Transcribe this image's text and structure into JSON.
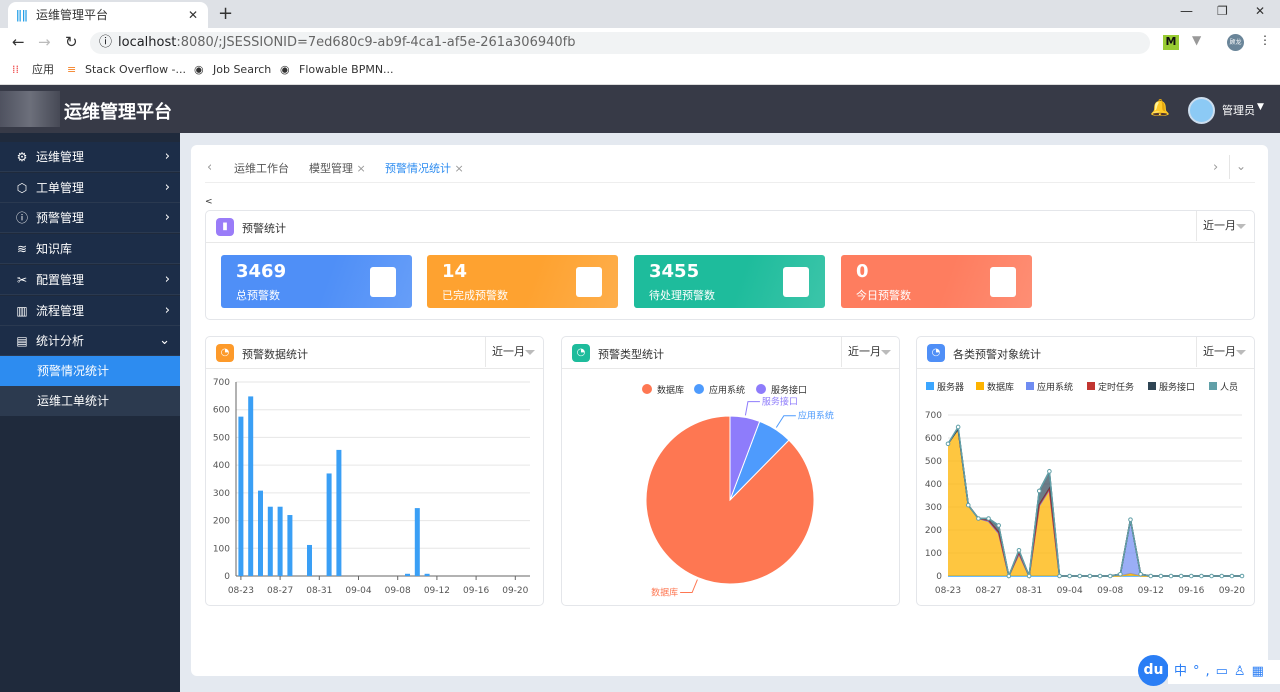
{
  "browser": {
    "tab_title": "运维管理平台",
    "url_host": "localhost",
    "url_rest": ":8080/;JSESSIONID=7ed680c9-ab9f-4ca1-af5e-261a306940fb",
    "bookmarks": [
      "应用",
      "Stack Overflow -...",
      "Job Search",
      "Flowable BPMN..."
    ],
    "profile": "顾龙"
  },
  "header": {
    "title": "运维管理平台",
    "user": "管理员"
  },
  "sidebar": {
    "items": [
      {
        "icon": "gear-icon",
        "label": "运维管理",
        "chev": "›"
      },
      {
        "icon": "cube-icon",
        "label": "工单管理",
        "chev": "›"
      },
      {
        "icon": "info-icon",
        "label": "预警管理",
        "chev": "›"
      },
      {
        "icon": "layers-icon",
        "label": "知识库",
        "chev": ""
      },
      {
        "icon": "tools-icon",
        "label": "配置管理",
        "chev": "›"
      },
      {
        "icon": "flow-icon",
        "label": "流程管理",
        "chev": "›"
      },
      {
        "icon": "calendar-icon",
        "label": "统计分析",
        "chev": "⌄"
      }
    ],
    "subitems": [
      {
        "label": "预警情况统计",
        "active": true
      },
      {
        "label": "运维工单统计",
        "active": false
      }
    ]
  },
  "tabs": [
    {
      "label": "运维工作台",
      "closable": false
    },
    {
      "label": "模型管理",
      "closable": true
    },
    {
      "label": "预警情况统计",
      "closable": true,
      "active": true
    }
  ],
  "back_link": "<",
  "stats_panel": {
    "title": "预警统计",
    "filter": "近一月",
    "cards": [
      {
        "value": "3469",
        "label": "总预警数",
        "color": "#4f8ff7"
      },
      {
        "value": "14",
        "label": "已完成预警数",
        "color": "#fea230"
      },
      {
        "value": "3455",
        "label": "待处理预警数",
        "color": "#1ebc9c"
      },
      {
        "value": "0",
        "label": "今日预警数",
        "color": "#fe7d5f"
      }
    ]
  },
  "panels": [
    {
      "title": "预警数据统计",
      "filter": "近一月",
      "icon_color": "#fd9a2a"
    },
    {
      "title": "预警类型统计",
      "filter": "近一月",
      "icon_color": "#1ebc9c"
    },
    {
      "title": "各类预警对象统计",
      "filter": "近一月",
      "icon_color": "#4f8ff7"
    }
  ],
  "chart_data": [
    {
      "type": "bar",
      "dates": [
        "08-23",
        "08-24",
        "08-25",
        "08-26",
        "08-27",
        "08-28",
        "08-29",
        "08-30",
        "08-31",
        "09-01",
        "09-02",
        "09-03",
        "09-04",
        "09-05",
        "09-06",
        "09-07",
        "09-08",
        "09-09",
        "09-10",
        "09-11",
        "09-12",
        "09-13",
        "09-14",
        "09-15",
        "09-16",
        "09-17",
        "09-18",
        "09-19",
        "09-20",
        "09-21"
      ],
      "values": [
        575,
        648,
        308,
        250,
        250,
        220,
        0,
        112,
        0,
        370,
        455,
        0,
        0,
        0,
        0,
        0,
        0,
        8,
        245,
        8,
        0,
        0,
        0,
        0,
        0,
        0,
        0,
        0,
        0,
        0
      ],
      "ylim": [
        0,
        700
      ],
      "yticks": [
        0,
        100,
        200,
        300,
        400,
        500,
        600,
        700
      ],
      "xtick_labels": [
        "08-23",
        "08-27",
        "08-31",
        "09-04",
        "09-08",
        "09-12",
        "09-16",
        "09-20"
      ],
      "color": "#3a9ff5"
    },
    {
      "type": "pie",
      "legend": [
        "数据库",
        "应用系统",
        "服务接口"
      ],
      "slices": [
        {
          "name": "数据库",
          "value": 3040,
          "color": "#fe7752"
        },
        {
          "name": "应用系统",
          "value": 230,
          "color": "#4e9bfd"
        },
        {
          "name": "服务接口",
          "value": 199,
          "color": "#8e7cfb"
        }
      ]
    },
    {
      "type": "area",
      "stacked": true,
      "ylim": [
        0,
        700
      ],
      "yticks": [
        0,
        100,
        200,
        300,
        400,
        500,
        600,
        700
      ],
      "xtick_labels": [
        "08-23",
        "08-27",
        "08-31",
        "09-04",
        "09-08",
        "09-12",
        "09-16",
        "09-20"
      ],
      "series": [
        {
          "name": "服务器",
          "color": "#3ba6ff",
          "values": [
            0,
            0,
            0,
            0,
            0,
            0,
            0,
            0,
            0,
            0,
            0,
            0,
            0,
            0,
            0,
            0,
            0,
            0,
            0,
            0,
            0,
            0,
            0,
            0,
            0,
            0,
            0,
            0,
            0,
            0
          ]
        },
        {
          "name": "数据库",
          "color": "#fdb300",
          "values": [
            575,
            640,
            308,
            250,
            238,
            185,
            0,
            95,
            0,
            305,
            375,
            0,
            0,
            0,
            0,
            0,
            0,
            0,
            10,
            0,
            0,
            0,
            0,
            0,
            0,
            0,
            0,
            0,
            0,
            0
          ]
        },
        {
          "name": "应用系统",
          "color": "#6f8cf2",
          "values": [
            0,
            0,
            0,
            0,
            0,
            0,
            0,
            0,
            0,
            0,
            0,
            0,
            0,
            0,
            0,
            0,
            0,
            8,
            235,
            8,
            0,
            0,
            0,
            0,
            0,
            0,
            0,
            0,
            0,
            0
          ]
        },
        {
          "name": "定时任务",
          "color": "#c23531",
          "values": [
            0,
            0,
            0,
            0,
            4,
            5,
            0,
            5,
            0,
            5,
            5,
            0,
            0,
            0,
            0,
            0,
            0,
            0,
            0,
            0,
            0,
            0,
            0,
            0,
            0,
            0,
            0,
            0,
            0,
            0
          ]
        },
        {
          "name": "服务接口",
          "color": "#2f4554",
          "values": [
            0,
            0,
            0,
            0,
            8,
            30,
            0,
            12,
            0,
            60,
            75,
            0,
            0,
            0,
            0,
            0,
            0,
            0,
            0,
            0,
            0,
            0,
            0,
            0,
            0,
            0,
            0,
            0,
            0,
            0
          ]
        },
        {
          "name": "人员",
          "color": "#61a0a8",
          "values": [
            0,
            8,
            0,
            0,
            0,
            0,
            0,
            0,
            0,
            0,
            0,
            0,
            0,
            0,
            0,
            0,
            0,
            0,
            0,
            0,
            0,
            0,
            0,
            0,
            0,
            0,
            0,
            0,
            0,
            0
          ]
        }
      ]
    }
  ]
}
